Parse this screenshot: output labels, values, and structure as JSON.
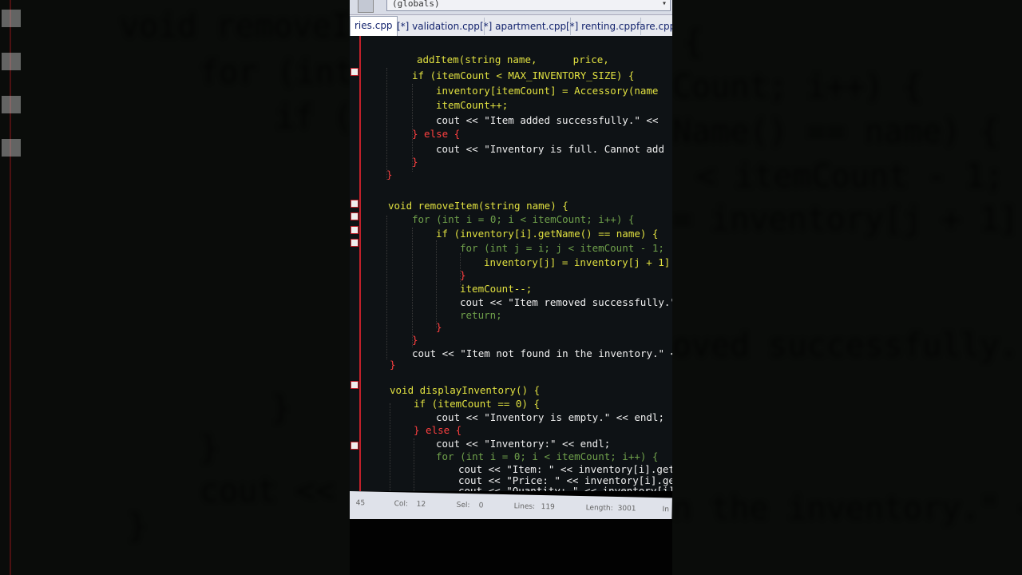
{
  "editor": {
    "globals_combo": "(globals)",
    "tabs": [
      {
        "label": "ries.cpp",
        "active": true
      },
      {
        "label": "[*] validation.cpp",
        "active": false
      },
      {
        "label": "[*] apartment.cpp",
        "active": false
      },
      {
        "label": "[*] renting.cpp",
        "active": false
      },
      {
        "label": "fare.cpp",
        "active": false
      }
    ],
    "status": {
      "line_label": "45",
      "col_label": "Col:",
      "col_value": "12",
      "sel_label": "Sel:",
      "sel_value": "0",
      "lines_label": "Lines:",
      "lines_value": "119",
      "length_label": "Length:",
      "length_value": "3001",
      "ins_label": "In"
    }
  },
  "code_lines": [
    "addItem(string name,      price,",
    "if (itemCount < MAX_INVENTORY_SIZE) {",
    "inventory[itemCount] = Accessory(name",
    "itemCount++;",
    "cout << \"Item added successfully.\" <<",
    "} else {",
    "cout << \"Inventory is full. Cannot add",
    "}",
    "}",
    "void removeItem(string name) {",
    "for (int i = 0; i < itemCount; i++) {",
    "if (inventory[i].getName() == name) {",
    "for (int j = i; j < itemCount - 1;",
    "inventory[j] = inventory[j + 1]",
    "}",
    "itemCount--;",
    "cout << \"Item removed successfully.\"",
    "return;",
    "}",
    "}",
    "cout << \"Item not found in the inventory.\" <",
    "}",
    "void displayInventory() {",
    "if (itemCount == 0) {",
    "cout << \"Inventory is empty.\" << endl;",
    "} else {",
    "cout << \"Inventory:\" << endl;",
    "for (int i = 0; i < itemCount; i++) {",
    "cout << \"Item: \" << inventory[i].getNa",
    "cout << \"Price: \" << inventory[i].getP",
    "cout << \"Quantity: \" << inventory[i].g"
  ],
  "background_left": [
    "void removeI",
    "for (int",
    "if (",
    "}",
    "}",
    "cout <<",
    "}"
  ],
  "background_right": [
    "{",
    "Count; i++) {",
    "Name() == name) {",
    "< itemCount - 1;",
    "= inventory[j + 1]",
    "oved successfully.",
    "n the inventory.\" <"
  ]
}
